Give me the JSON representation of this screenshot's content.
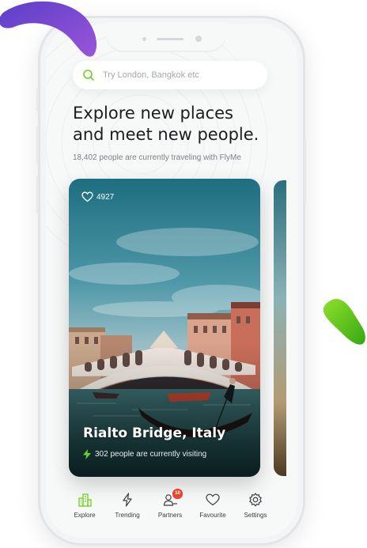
{
  "colors": {
    "accent_green": "#6bd21c",
    "blob_purple": "#7b4ccf",
    "badge_red": "#e8452c",
    "text_dark": "#1c1d1f",
    "text_muted": "#7c8185"
  },
  "search": {
    "placeholder": "Try London, Bangkok etc",
    "icon": "search-icon"
  },
  "hero": {
    "title_line1": "Explore new places",
    "title_line2": "and meet new people.",
    "subtitle": "18,402 people are currently traveling with FlyMe"
  },
  "cards": [
    {
      "likes": "4927",
      "like_icon": "heart-icon",
      "title": "Rialto Bridge, Italy",
      "visitors": "302 people are currently visiting",
      "visitors_icon": "bolt-icon"
    }
  ],
  "nav": {
    "items": [
      {
        "label": "Explore",
        "icon": "buildings-icon"
      },
      {
        "label": "Trending",
        "icon": "bolt-icon"
      },
      {
        "label": "Partners",
        "icon": "user-add-icon",
        "badge": "10"
      },
      {
        "label": "Favourite",
        "icon": "heart-icon"
      },
      {
        "label": "Settings",
        "icon": "gear-icon"
      }
    ]
  }
}
